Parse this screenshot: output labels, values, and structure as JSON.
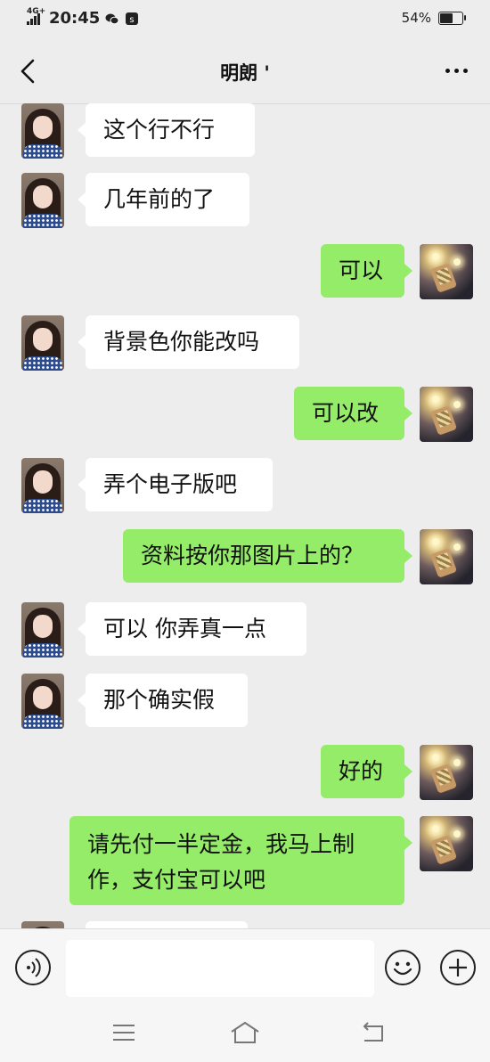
{
  "status_bar": {
    "network": "4G+",
    "time": "20:45",
    "battery_percent": "54%",
    "battery_level": 0.54
  },
  "header": {
    "title": "明朗 '"
  },
  "messages": [
    {
      "side": "left",
      "text": "这个行不行"
    },
    {
      "side": "left",
      "text": "几年前的了"
    },
    {
      "side": "right",
      "text": "可以"
    },
    {
      "side": "left",
      "text": "背景色你能改吗"
    },
    {
      "side": "right",
      "text": "可以改"
    },
    {
      "side": "left",
      "text": "弄个电子版吧"
    },
    {
      "side": "right",
      "text": "资料按你那图片上的？"
    },
    {
      "side": "left",
      "text": "可以 你弄真一点"
    },
    {
      "side": "left",
      "text": "那个确实假"
    },
    {
      "side": "right",
      "text": "好的"
    },
    {
      "side": "right",
      "text": "请先付一半定金，我马上制作，支付宝可以吧"
    }
  ],
  "input_bar": {
    "placeholder": "",
    "icons": [
      "voice-icon",
      "emoji-icon",
      "plus-icon"
    ]
  },
  "system_nav": {
    "icons": [
      "menu-icon",
      "home-icon",
      "back-icon"
    ]
  }
}
